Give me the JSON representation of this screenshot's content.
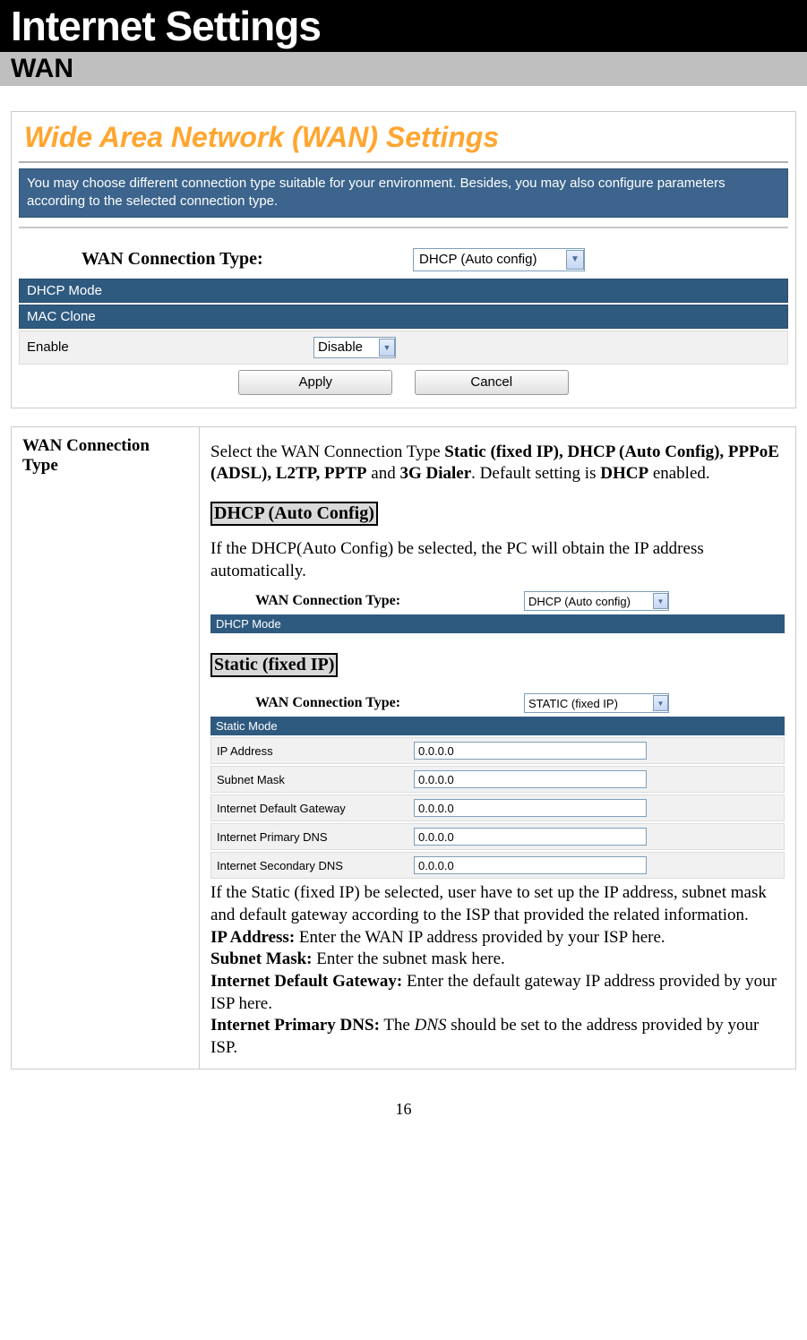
{
  "page": {
    "title": "Internet Settings",
    "subtitle": "WAN",
    "number": "16"
  },
  "router_panel": {
    "header": "Wide Area Network (WAN) Settings",
    "info": "You may choose different connection type suitable for your environment. Besides, you may also configure parameters according to the selected connection type.",
    "conn_label": "WAN Connection Type:",
    "conn_value": "DHCP (Auto config)",
    "band1": "DHCP Mode",
    "band2": "MAC Clone",
    "enable_label": "Enable",
    "enable_value": "Disable",
    "apply": "Apply",
    "cancel": "Cancel"
  },
  "desc": {
    "left": "WAN Connection Type",
    "intro_pre": "Select the WAN Connection Type ",
    "intro_bold1": "Static (fixed IP), DHCP (Auto Config), PPPoE (ADSL), L2TP, PPTP",
    "intro_mid": " and ",
    "intro_bold2": "3G Dialer",
    "intro_mid2": ". Default setting is ",
    "intro_bold3": "DHCP",
    "intro_end": " enabled.",
    "dhcp_head": "DHCP (Auto Config)",
    "dhcp_text": "If the DHCP(Auto Config) be selected, the PC will obtain the IP address automatically.",
    "dhcp_mini": {
      "label": "WAN Connection Type:",
      "value": "DHCP (Auto config)",
      "band": "DHCP Mode"
    },
    "static_head": "Static (fixed IP)",
    "static_mini": {
      "label": "WAN Connection Type:",
      "value": "STATIC (fixed IP)",
      "band": "Static Mode",
      "rows": [
        {
          "label": "IP Address",
          "value": "0.0.0.0"
        },
        {
          "label": "Subnet Mask",
          "value": "0.0.0.0"
        },
        {
          "label": "Internet Default Gateway",
          "value": "0.0.0.0"
        },
        {
          "label": "Internet Primary DNS",
          "value": "0.0.0.0"
        },
        {
          "label": "Internet Secondary DNS",
          "value": "0.0.0.0"
        }
      ]
    },
    "static_para": "If the Static (fixed IP) be selected, user have to set up the IP address, subnet mask and default gateway according to the ISP that provided the related information.",
    "ip_b": "IP Address:",
    "ip_t": " Enter the WAN IP address provided by your ISP here.",
    "sn_b": "Subnet Mask:",
    "sn_t": " Enter the subnet mask here.",
    "gw_b": "Internet Default Gateway:",
    "gw_t": " Enter the default gateway IP address provided by your ISP here.",
    "dns_b": "Internet Primary DNS:",
    "dns_t1": " The ",
    "dns_i": "DNS",
    "dns_t2": " should be set to the address provided by your ISP."
  }
}
